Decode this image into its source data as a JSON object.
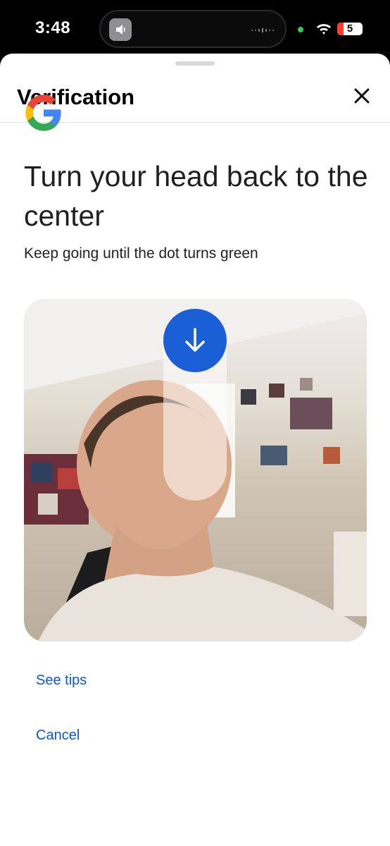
{
  "status_bar": {
    "time": "3:48",
    "battery": "5"
  },
  "sheet": {
    "title": "Verification",
    "close_icon": "close-icon"
  },
  "content": {
    "headline": "Turn your head back to the center",
    "subtitle": "Keep going until the dot turns green",
    "direction_icon": "arrow-down-icon"
  },
  "actions": {
    "see_tips": "See tips",
    "cancel": "Cancel"
  },
  "colors": {
    "accent": "#1a5fd6",
    "link": "#0b57d0"
  }
}
